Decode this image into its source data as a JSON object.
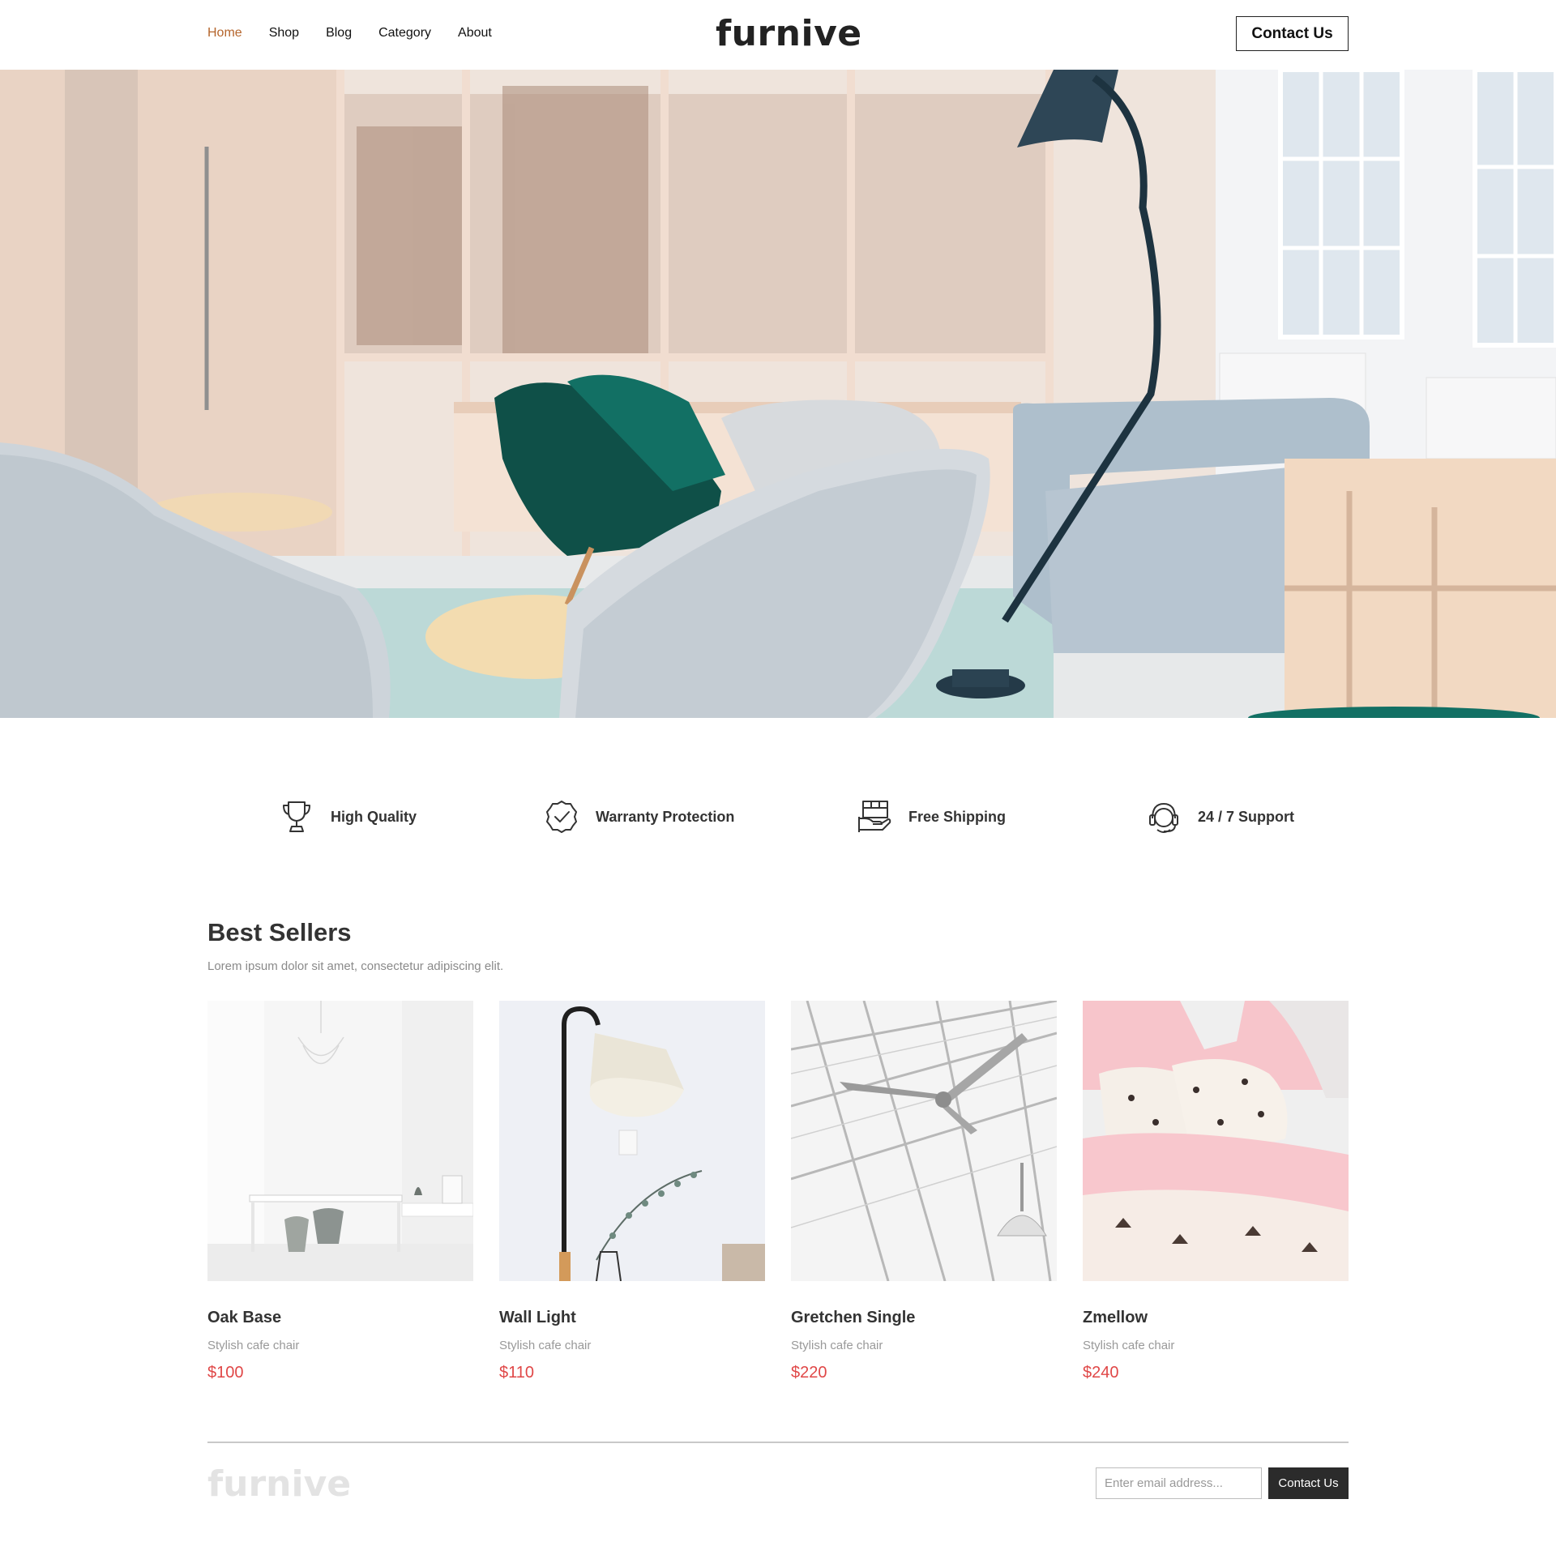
{
  "header": {
    "nav": [
      "Home",
      "Shop",
      "Blog",
      "Category",
      "About"
    ],
    "active_nav": "Home",
    "logo": "furnive",
    "contact_label": "Contact Us"
  },
  "features": [
    {
      "label": "High Quality",
      "icon": "trophy-icon"
    },
    {
      "label": "Warranty Protection",
      "icon": "badge-check-icon"
    },
    {
      "label": "Free Shipping",
      "icon": "package-hand-icon"
    },
    {
      "label": "24 / 7 Support",
      "icon": "headset-icon"
    }
  ],
  "best_sellers": {
    "title": "Best Sellers",
    "subtitle": "Lorem ipsum dolor sit amet, consectetur adipiscing elit.",
    "products": [
      {
        "name": "Oak Base",
        "desc": "Stylish cafe chair",
        "price": "$100"
      },
      {
        "name": "Wall Light",
        "desc": "Stylish cafe chair",
        "price": "$110"
      },
      {
        "name": "Gretchen Single",
        "desc": "Stylish cafe chair",
        "price": "$220"
      },
      {
        "name": "Zmellow",
        "desc": "Stylish cafe chair",
        "price": "$240"
      }
    ]
  },
  "footer": {
    "logo": "furnive",
    "email_placeholder": "Enter email address...",
    "button_label": "Contact Us"
  },
  "colors": {
    "accent_nav": "#b5652c",
    "price": "#e04747",
    "button_dark": "#2b2b2b"
  }
}
